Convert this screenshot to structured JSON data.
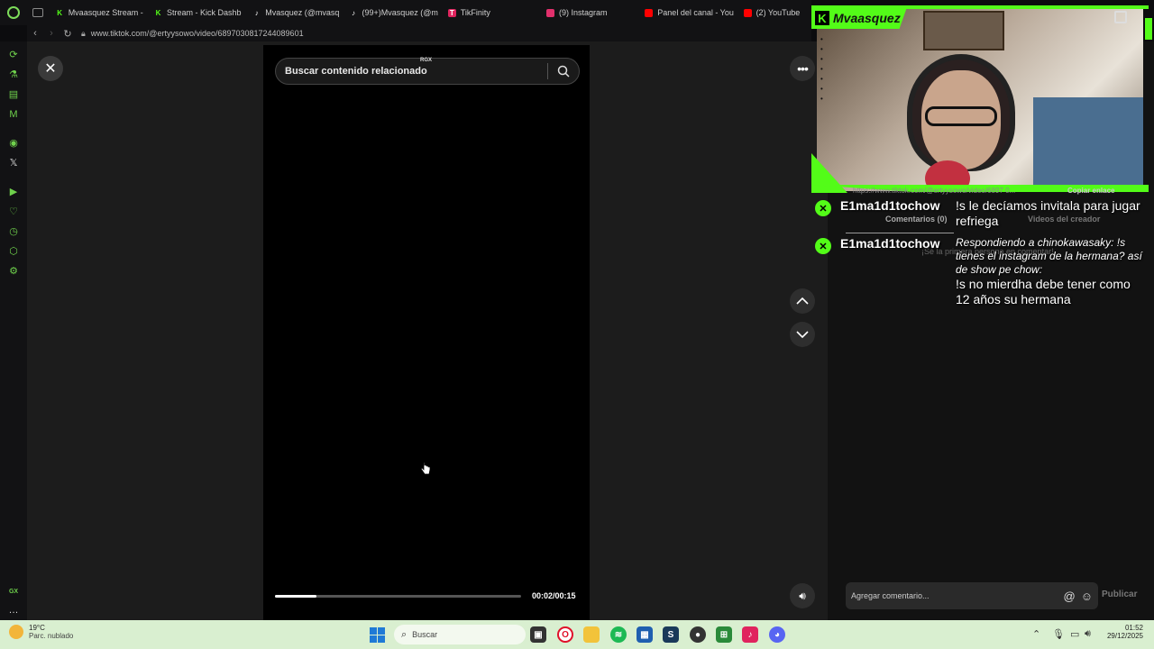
{
  "browser": {
    "tabs": [
      {
        "label": "Mvaasquez Stream -",
        "icon": "kick-icon",
        "color": "#53fc18"
      },
      {
        "label": "Stream - Kick Dashb",
        "icon": "kick-icon",
        "color": "#53fc18"
      },
      {
        "label": "Mvasquez (@mvasq",
        "icon": "tiktok-icon",
        "color": "#ffffff"
      },
      {
        "label": "(99+)Mvasquez (@m",
        "icon": "tiktok-icon",
        "color": "#ffffff"
      },
      {
        "label": "TikFinity",
        "icon": "tikfinity-icon",
        "color": "#e0245e"
      },
      {
        "label": "(9) Instagram",
        "icon": "instagram-icon",
        "color": "#e1306c"
      },
      {
        "label": "Panel del canal - You",
        "icon": "youtube-icon",
        "color": "#ff0000"
      },
      {
        "label": "(2) YouTube",
        "icon": "youtube-icon",
        "color": "#ff0000"
      }
    ],
    "url": "www.tiktok.com/@ertyysowo/video/6897030817244089601"
  },
  "player": {
    "search_placeholder": "Buscar contenido relacionado",
    "rgx_badge": "RGX",
    "time": "00:02/00:15",
    "progress": 0.17
  },
  "side_panel": {
    "comment_placeholder": "Agregar comentario...",
    "publish_label": "Publicar",
    "url_faint": "https://www.tiktok.com/@ertyysowo/video/6897 0...",
    "copy_link": "Copiar enlace",
    "comments_label": "Comentarios (0)",
    "creator_videos": "Videos del creador",
    "first_comment": "¡Sé la primera persona en comentar!"
  },
  "overlay": {
    "channel": "Mvaasquez",
    "brand_color": "#53fc18"
  },
  "chat": [
    {
      "user": "E1ma1d1tochow",
      "text": "!s le decíamos invitala para jugar refriega",
      "reply": ""
    },
    {
      "user": "E1ma1d1tochow",
      "text": "!s no mierdha debe tener como 12 años su hermana",
      "reply": "Respondiendo a chinokawasaky: !s tienes el instagram de la hermana? así de show pe chow:"
    }
  ],
  "taskbar": {
    "temp": "19°C",
    "weather": "Parc. nublado",
    "search_label": "Buscar",
    "time": "01:52",
    "date": "29/12/2025"
  }
}
